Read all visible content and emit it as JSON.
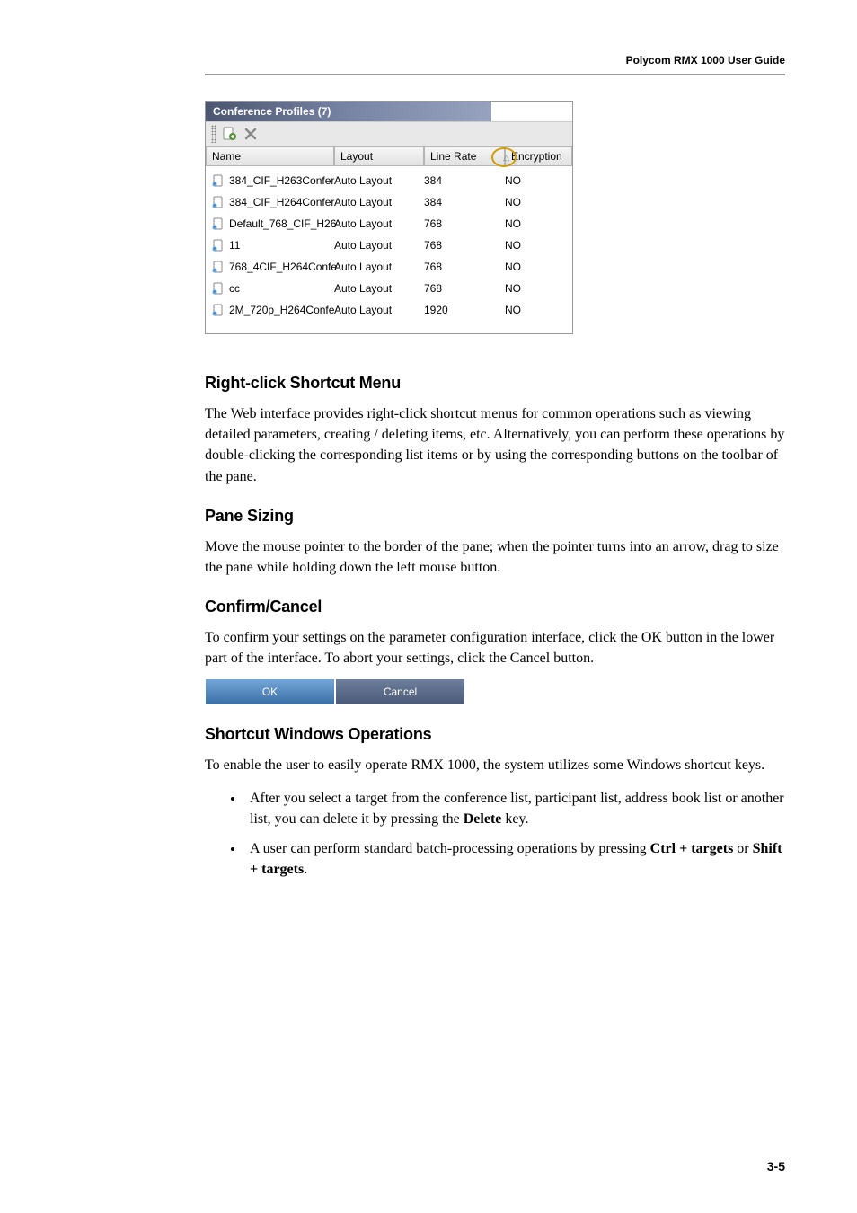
{
  "header": {
    "title": "Polycom RMX 1000 User Guide"
  },
  "panel": {
    "title": "Conference Profiles (7)",
    "columns": {
      "name": "Name",
      "layout": "Layout",
      "rate": "Line Rate",
      "enc": "Encryption"
    },
    "rows": [
      {
        "name": "384_CIF_H263Confer",
        "layout": "Auto Layout",
        "rate": "384",
        "enc": "NO"
      },
      {
        "name": "384_CIF_H264Confer",
        "layout": "Auto Layout",
        "rate": "384",
        "enc": "NO"
      },
      {
        "name": "Default_768_CIF_H26",
        "layout": "Auto Layout",
        "rate": "768",
        "enc": "NO"
      },
      {
        "name": "11",
        "layout": "Auto Layout",
        "rate": "768",
        "enc": "NO"
      },
      {
        "name": "768_4CIF_H264Confe",
        "layout": "Auto Layout",
        "rate": "768",
        "enc": "NO"
      },
      {
        "name": "cc",
        "layout": "Auto Layout",
        "rate": "768",
        "enc": "NO"
      },
      {
        "name": "2M_720p_H264Confe",
        "layout": "Auto Layout",
        "rate": "1920",
        "enc": "NO"
      }
    ]
  },
  "sections": {
    "right_click": {
      "heading": "Right-click Shortcut Menu",
      "body": "The Web interface provides right-click shortcut menus for common operations such as viewing detailed parameters, creating / deleting items, etc. Alternatively, you can perform these operations by double-clicking the corresponding list items or by using the corresponding buttons on the toolbar of the pane."
    },
    "pane_sizing": {
      "heading": "Pane Sizing",
      "body": "Move the mouse pointer to the border of the pane; when the pointer turns into an arrow, drag to size the pane while holding down the left mouse button."
    },
    "confirm": {
      "heading": "Confirm/Cancel",
      "body": "To confirm your settings on the parameter configuration interface, click the OK button in the lower part of the interface. To abort your settings, click the Cancel button.",
      "ok": "OK",
      "cancel": "Cancel"
    },
    "shortcut": {
      "heading": "Shortcut Windows Operations",
      "body": "To enable the user to easily operate RMX 1000, the system utilizes some Windows shortcut keys.",
      "bullets": [
        {
          "pre": "After you select a target from the conference list, participant list, address book list or another list, you can delete it by pressing the ",
          "bold": "Delete",
          "post": " key."
        },
        {
          "pre": "A user can perform standard batch-processing operations by pressing ",
          "bold1": "Ctrl + targets",
          "mid": " or ",
          "bold2": "Shift + targets",
          "post": "."
        }
      ]
    }
  },
  "page_num": "3-5"
}
